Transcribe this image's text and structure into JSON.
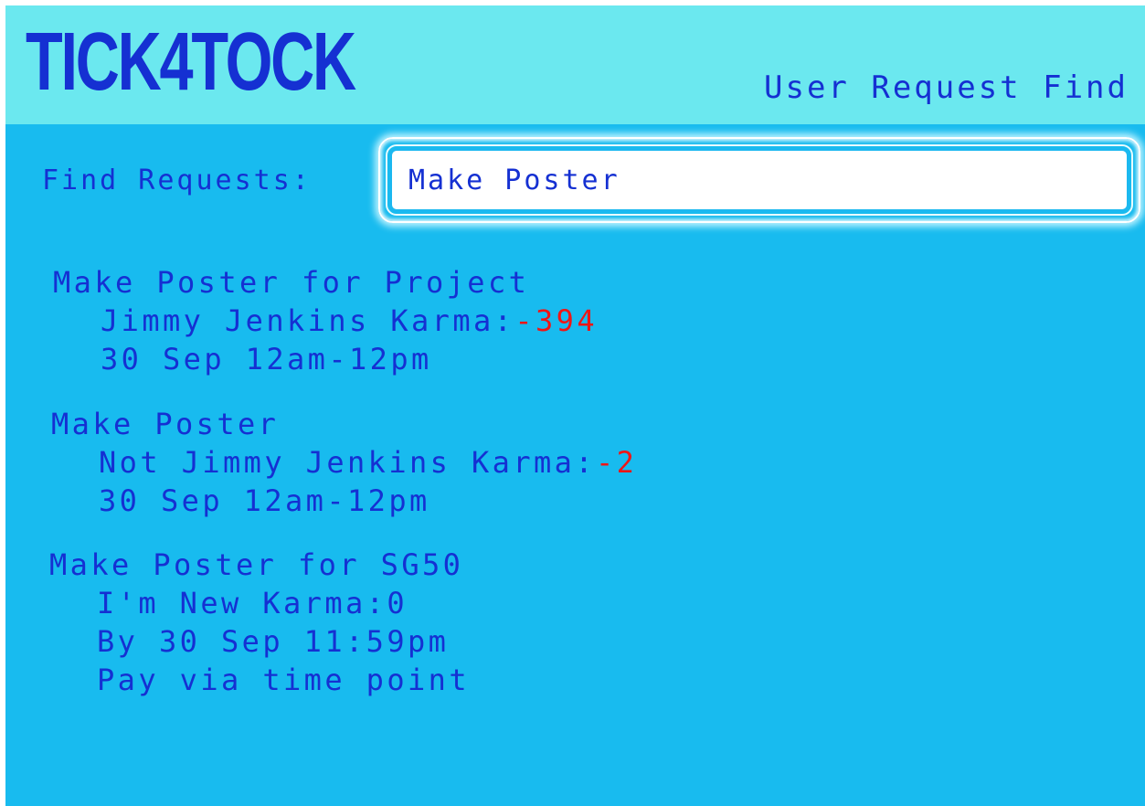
{
  "header": {
    "logo": "TICK4TOCK",
    "title": "User Request Find"
  },
  "search": {
    "label": "Find Requests:",
    "value": "Make Poster"
  },
  "results": [
    {
      "title": "Make Poster for Project",
      "user": "Jimmy Jenkins",
      "karma_label": "Karma:",
      "karma": "-394",
      "time": "30 Sep 12am-12pm"
    },
    {
      "title": "Make Poster",
      "user": "Not Jimmy Jenkins",
      "karma_label": "Karma:",
      "karma": "-2",
      "time": "30 Sep 12am-12pm"
    },
    {
      "title": "Make Poster for SG50",
      "user": "I'm New",
      "karma_label": "Karma:",
      "karma": "0",
      "time": "By 30 Sep 11:59pm",
      "payment": "Pay via time point"
    }
  ],
  "colors": {
    "header_bg": "#6be8ef",
    "main_bg": "#18bbef",
    "text": "#1530d2",
    "negative": "#f01515"
  }
}
